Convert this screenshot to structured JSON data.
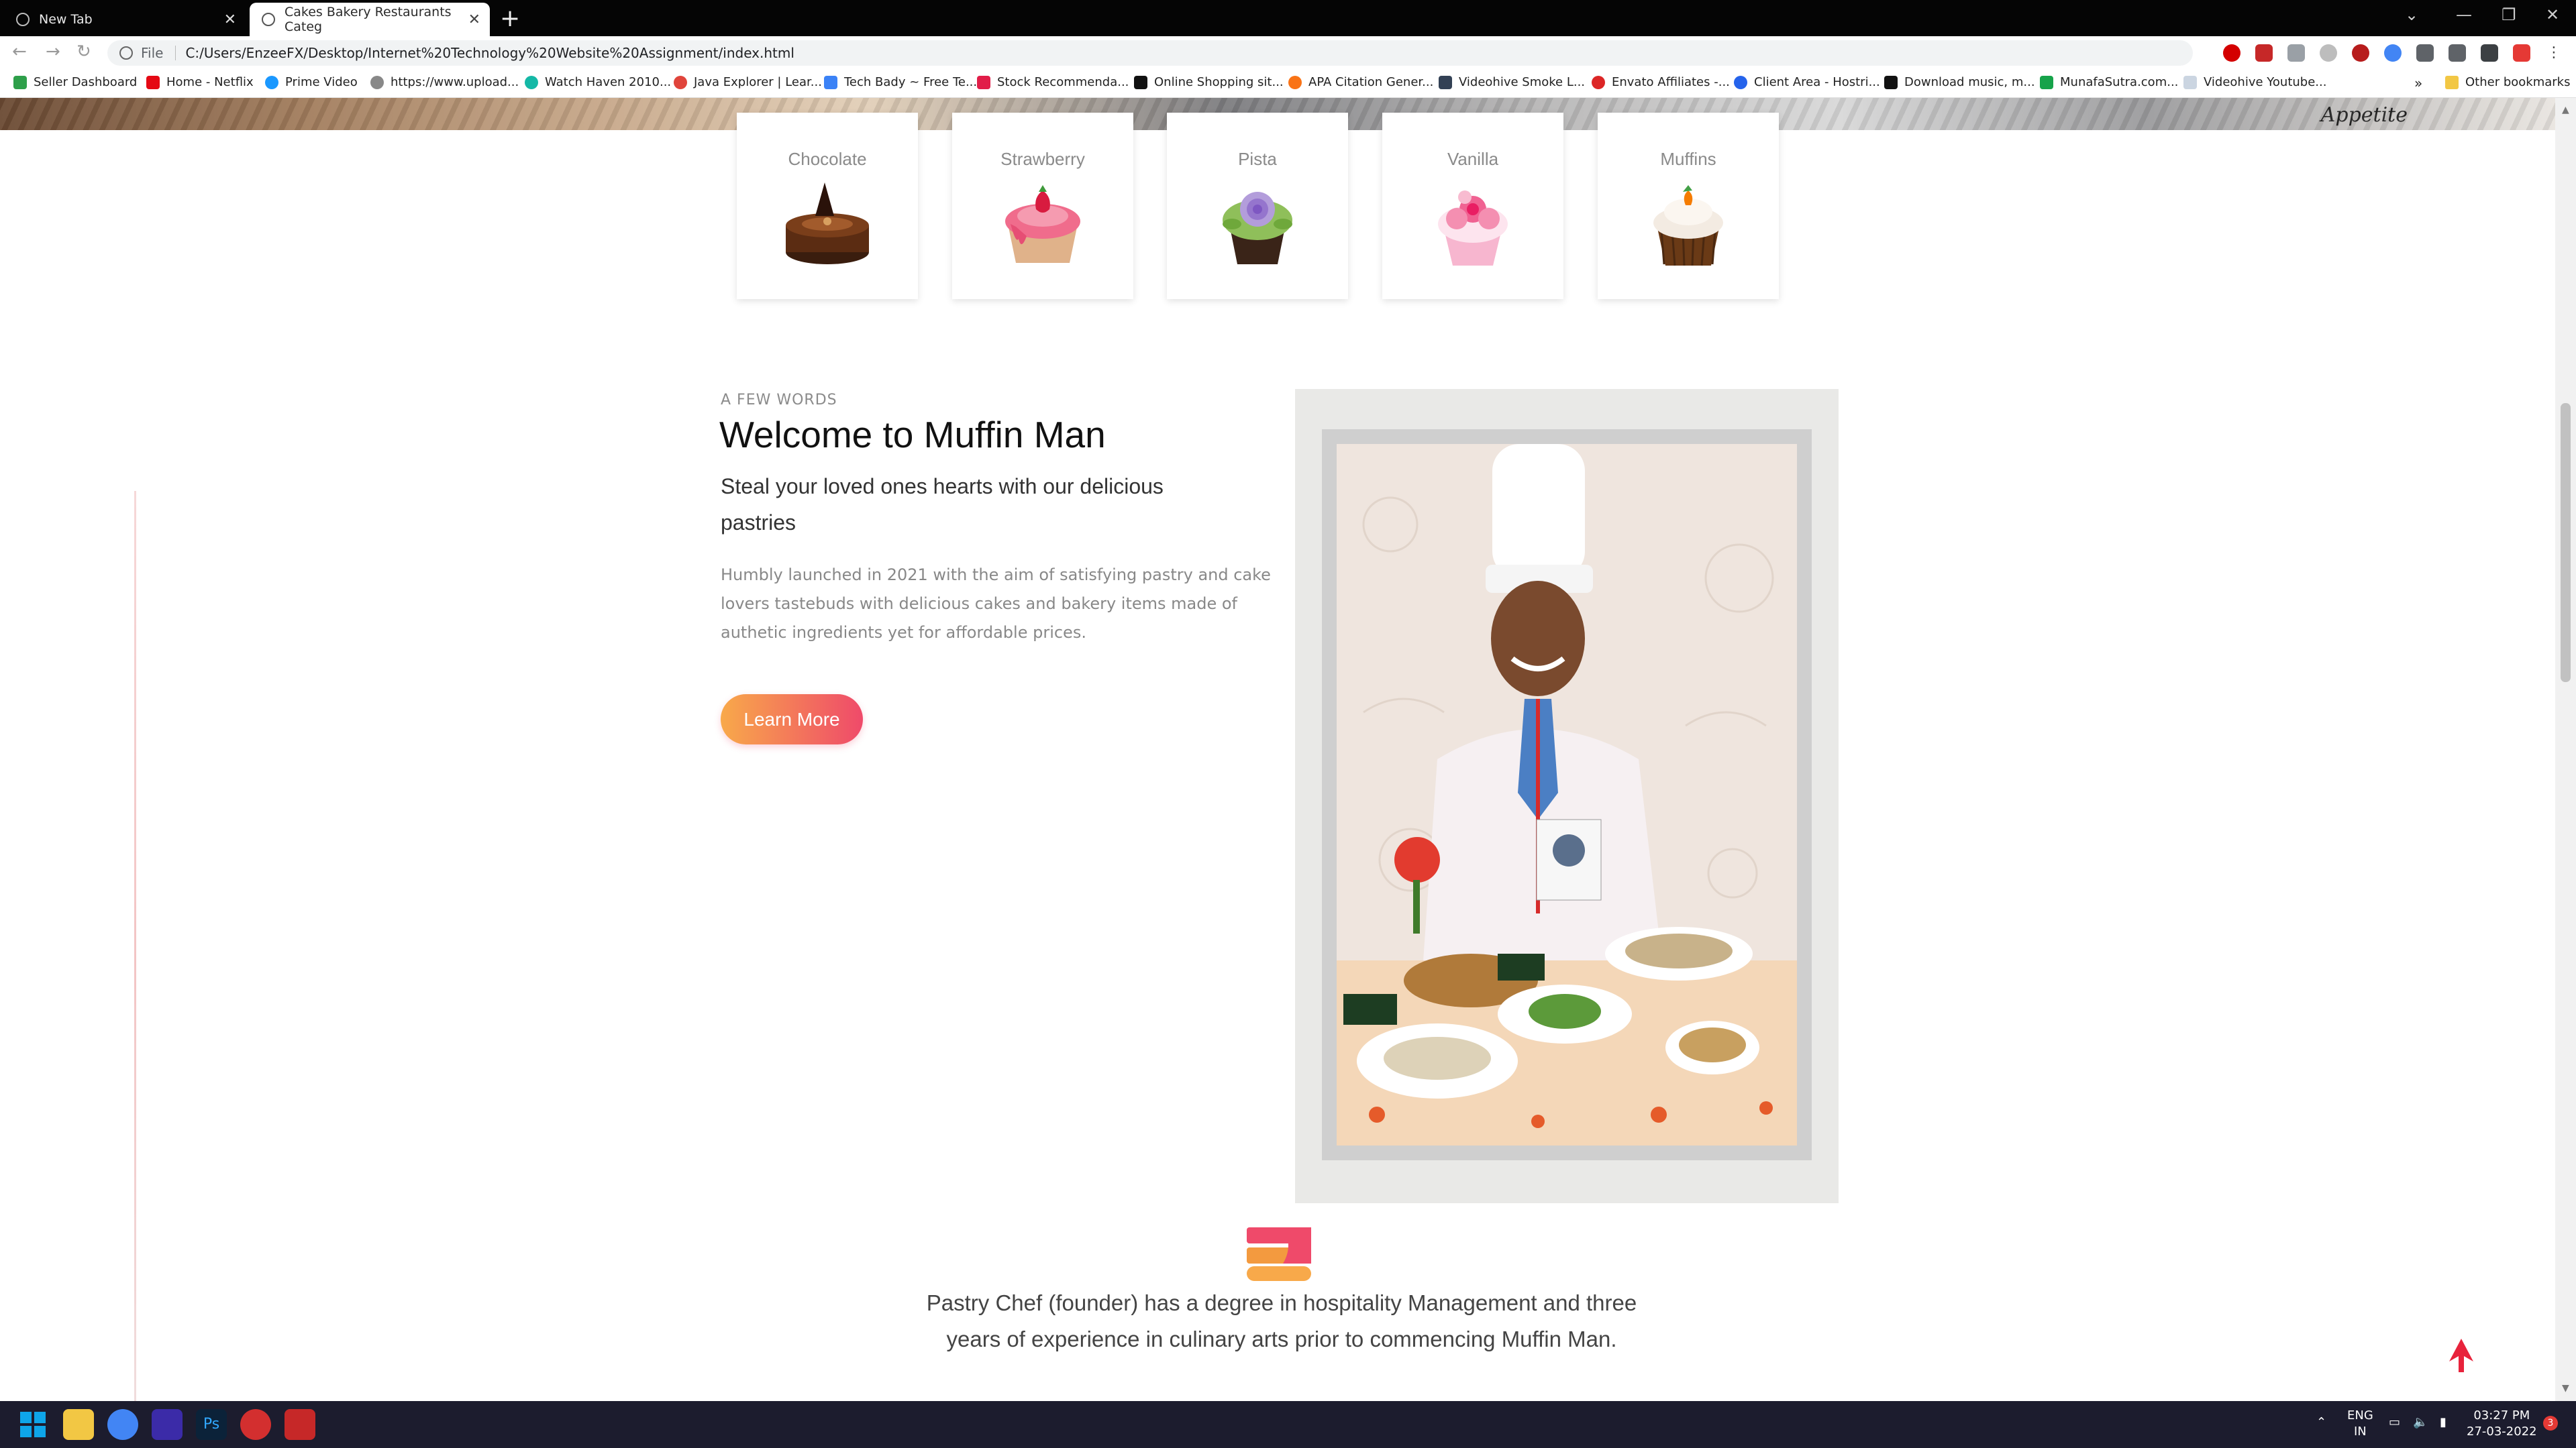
{
  "browser": {
    "tabs": [
      {
        "title": "New Tab",
        "active": false
      },
      {
        "title": "Cakes Bakery Restaurants Categ",
        "active": true
      }
    ],
    "new_tab": "+",
    "address": {
      "scheme_label": "File",
      "url": "C:/Users/EnzeeFX/Desktop/Internet%20Technology%20Website%20Assignment/index.html"
    },
    "bookmarks": [
      {
        "label": "Seller Dashboard",
        "color": "#2e9f4a"
      },
      {
        "label": "Home - Netflix",
        "color": "#e50914"
      },
      {
        "label": "Prime Video",
        "color": "#1a98ff"
      },
      {
        "label": "https://www.upload...",
        "color": "#888888"
      },
      {
        "label": "Watch Haven 2010...",
        "color": "#14b8a6"
      },
      {
        "label": "Java Explorer | Lear...",
        "color": "#e0443b"
      },
      {
        "label": "Tech Bady ~ Free Te...",
        "color": "#3b82f6"
      },
      {
        "label": "Stock Recommenda...",
        "color": "#e11d48"
      },
      {
        "label": "Online Shopping sit...",
        "color": "#111111"
      },
      {
        "label": "APA Citation Gener...",
        "color": "#f97316"
      },
      {
        "label": "Videohive Smoke L...",
        "color": "#334155"
      },
      {
        "label": "Envato Affiliates -...",
        "color": "#dc2626"
      },
      {
        "label": "Client Area - Hostri...",
        "color": "#2563eb"
      },
      {
        "label": "Download music, m...",
        "color": "#111111"
      },
      {
        "label": "MunafaSutra.com...",
        "color": "#16a34a"
      },
      {
        "label": "Videohive Youtube...",
        "color": "#cbd5e1"
      }
    ],
    "more_bookmarks": "»",
    "other_bookmarks": "Other bookmarks"
  },
  "page": {
    "hero_script": "Appetite",
    "categories": [
      {
        "name": "Chocolate",
        "icon": "chocolate-cake-icon"
      },
      {
        "name": "Strawberry",
        "icon": "strawberry-cupcake-icon"
      },
      {
        "name": "Pista",
        "icon": "pista-cupcake-icon"
      },
      {
        "name": "Vanilla",
        "icon": "vanilla-cupcake-icon"
      },
      {
        "name": "Muffins",
        "icon": "muffin-icon"
      }
    ],
    "about": {
      "eyebrow": "A FEW WORDS",
      "title": "Welcome to Muffin Man",
      "tagline": "Steal your loved ones hearts with our delicious pastries",
      "body": "Humbly launched in 2021 with the aim of satisfying pastry and cake lovers tastebuds with delicious cakes and bakery items made of authetic ingredients yet for affordable prices.",
      "button": "Learn More"
    },
    "chef": {
      "bio": "Pastry Chef (founder) has a degree in hospitality Management and three years of experience in culinary arts prior to commencing Muffin Man."
    },
    "accent_gradient": [
      "#f8a94a",
      "#ef4a6a"
    ]
  },
  "taskbar": {
    "tray_lang_1": "ENG",
    "tray_lang_2": "IN",
    "time": "03:27 PM",
    "date": "27-03-2022",
    "notification_count": "3"
  }
}
